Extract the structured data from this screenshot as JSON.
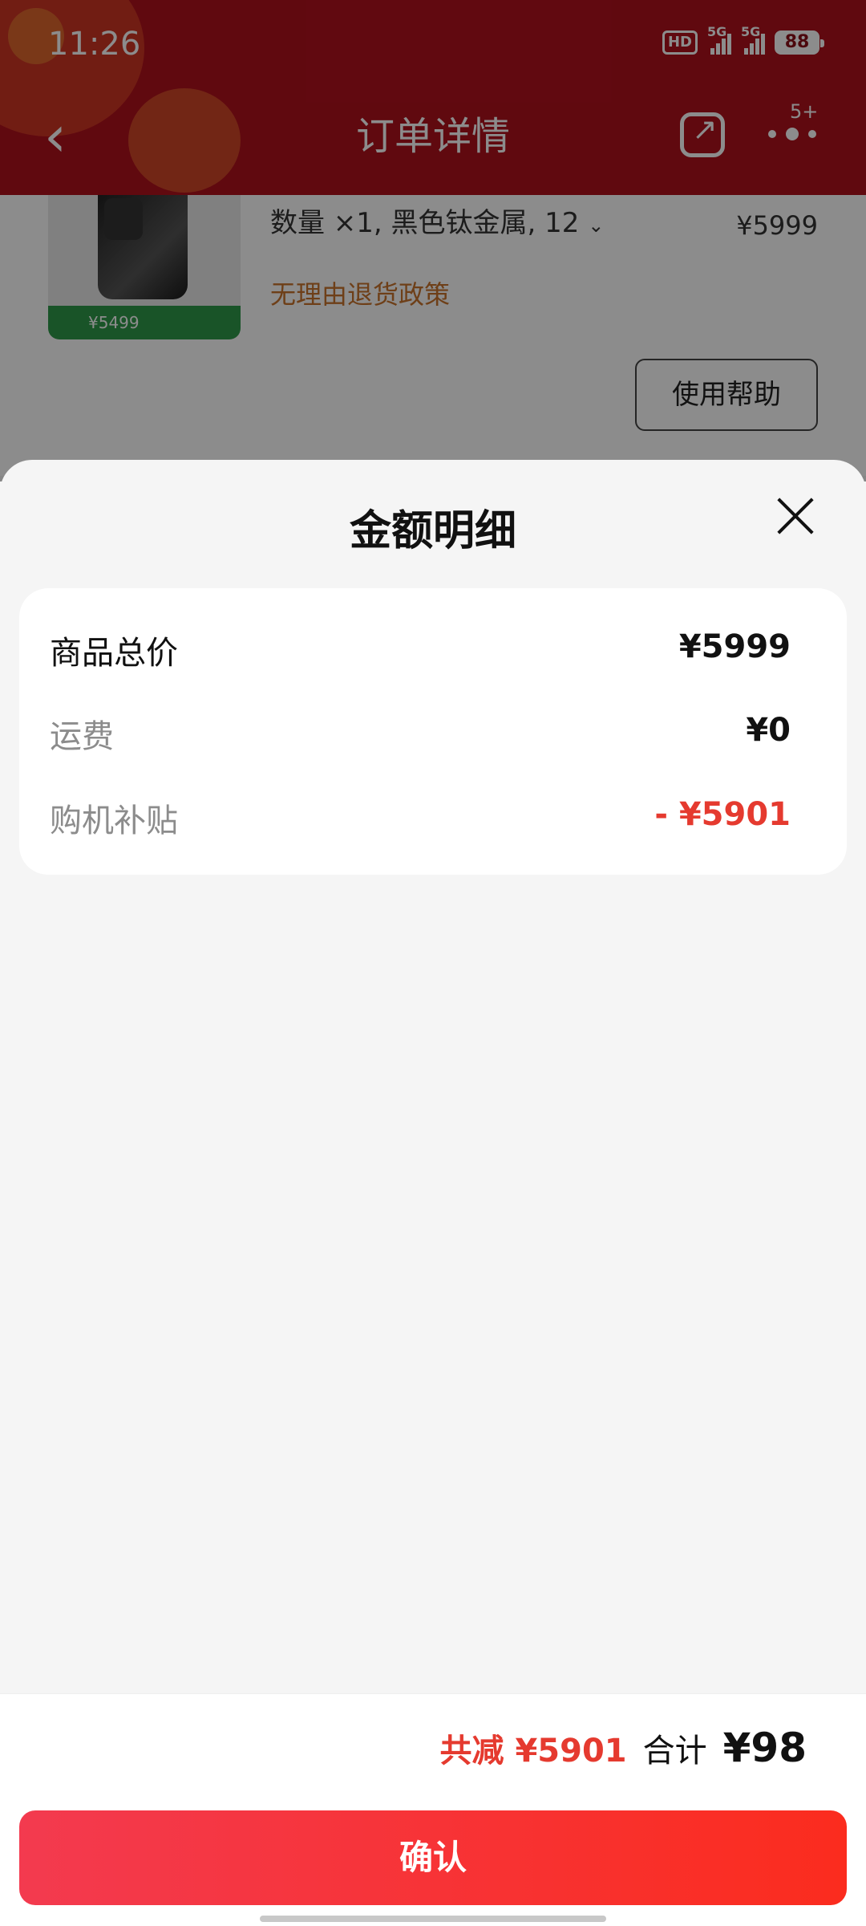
{
  "status_bar": {
    "time": "11:26",
    "hd_label": "HD",
    "network1": "5G",
    "network2": "5G",
    "battery": "88"
  },
  "nav": {
    "title": "订单详情",
    "badge": "5+"
  },
  "background_order": {
    "spec_text": "数量 ×1, 黑色钛金属, 12",
    "price": "¥5999",
    "policy": "无理由退货政策",
    "promo_price": "¥5499",
    "help_button": "使用帮助"
  },
  "sheet": {
    "title": "金额明细",
    "rows": [
      {
        "label": "商品总价",
        "value": "¥5999"
      },
      {
        "label": "运费",
        "value": "¥0"
      },
      {
        "label": "购机补贴",
        "value": "- ¥5901"
      }
    ]
  },
  "footer": {
    "saved": "共减 ¥5901",
    "total_label": "合计",
    "total_value": "¥98",
    "confirm_label": "确认"
  },
  "colors": {
    "header_red": "#b0111d",
    "accent_red": "#e53a2f",
    "policy_orange": "#c9732c",
    "sheet_bg": "#f5f5f5"
  }
}
